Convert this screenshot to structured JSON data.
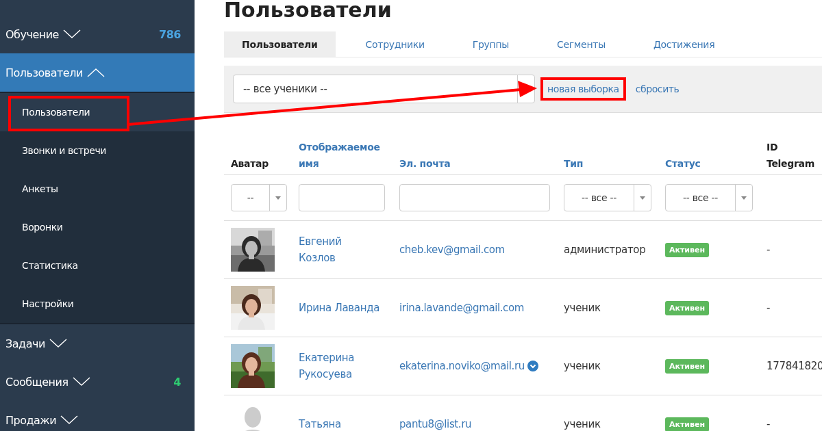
{
  "page_title": "Пользователи",
  "sidebar": {
    "items": [
      {
        "label": "Обучение",
        "expanded": false,
        "selected": false,
        "count": "786",
        "color": "#4aa3df"
      },
      {
        "label": "Пользователи",
        "expanded": true,
        "selected": true,
        "children": [
          {
            "label": "Пользователи",
            "selected": true
          },
          {
            "label": "Звонки и встречи",
            "selected": false
          },
          {
            "label": "Анкеты",
            "selected": false
          },
          {
            "label": "Воронки",
            "selected": false
          },
          {
            "label": "Статистика",
            "selected": false
          },
          {
            "label": "Настройки",
            "selected": false
          }
        ]
      },
      {
        "label": "Задачи",
        "expanded": false,
        "selected": false
      },
      {
        "label": "Сообщения",
        "expanded": false,
        "selected": false,
        "count": "4",
        "color": "#2ecc71"
      },
      {
        "label": "Продажи",
        "expanded": false,
        "selected": false
      }
    ]
  },
  "tabs": [
    {
      "label": "Пользователи",
      "selected": true
    },
    {
      "label": "Сотрудники",
      "selected": false
    },
    {
      "label": "Группы",
      "selected": false
    },
    {
      "label": "Сегменты",
      "selected": false
    },
    {
      "label": "Достижения",
      "selected": false
    }
  ],
  "filter_bar": {
    "segment_select": "-- все ученики --",
    "links": [
      "новая выборка",
      "сбросить"
    ]
  },
  "table": {
    "columns": [
      {
        "label": "Аватар",
        "link": false,
        "filter": {
          "kind": "select",
          "value": "--"
        }
      },
      {
        "label": "Отображаемое имя",
        "link": true,
        "filter": {
          "kind": "input"
        }
      },
      {
        "label": "Эл. почта",
        "link": true,
        "filter": {
          "kind": "input"
        }
      },
      {
        "label": "Тип",
        "link": true,
        "filter": {
          "kind": "select",
          "value": "-- все --"
        }
      },
      {
        "label": "Статус",
        "link": true,
        "filter": {
          "kind": "select",
          "value": "-- все --"
        }
      },
      {
        "label": "ID Telegram",
        "link": false,
        "filter": {
          "kind": "none"
        }
      }
    ],
    "rows": [
      {
        "avatar": {
          "kind": "picture"
        },
        "name": [
          "Евгений",
          "Козлов"
        ],
        "email": "cheb.kev@gmail.com",
        "verified": false,
        "type": "администратор",
        "status": "Активен",
        "telegram": "-"
      },
      {
        "avatar": {
          "kind": "picture"
        },
        "name": [
          "Ирина Лаванда"
        ],
        "email": "irina.lavande@gmail.com",
        "verified": false,
        "type": "ученик",
        "status": "Активен",
        "telegram": "-"
      },
      {
        "avatar": {
          "kind": "picture"
        },
        "name": [
          "Екатерина",
          "Рукосуева"
        ],
        "email": "ekaterina.noviko@mail.ru",
        "verified": true,
        "type": "ученик",
        "status": "Активен",
        "telegram": "177841820"
      },
      {
        "avatar": {
          "kind": "placeholder"
        },
        "name": [
          "Татьяна"
        ],
        "email": "pantu8@list.ru",
        "verified": false,
        "type": "ученик",
        "status": "Активен",
        "telegram": "-"
      }
    ]
  }
}
